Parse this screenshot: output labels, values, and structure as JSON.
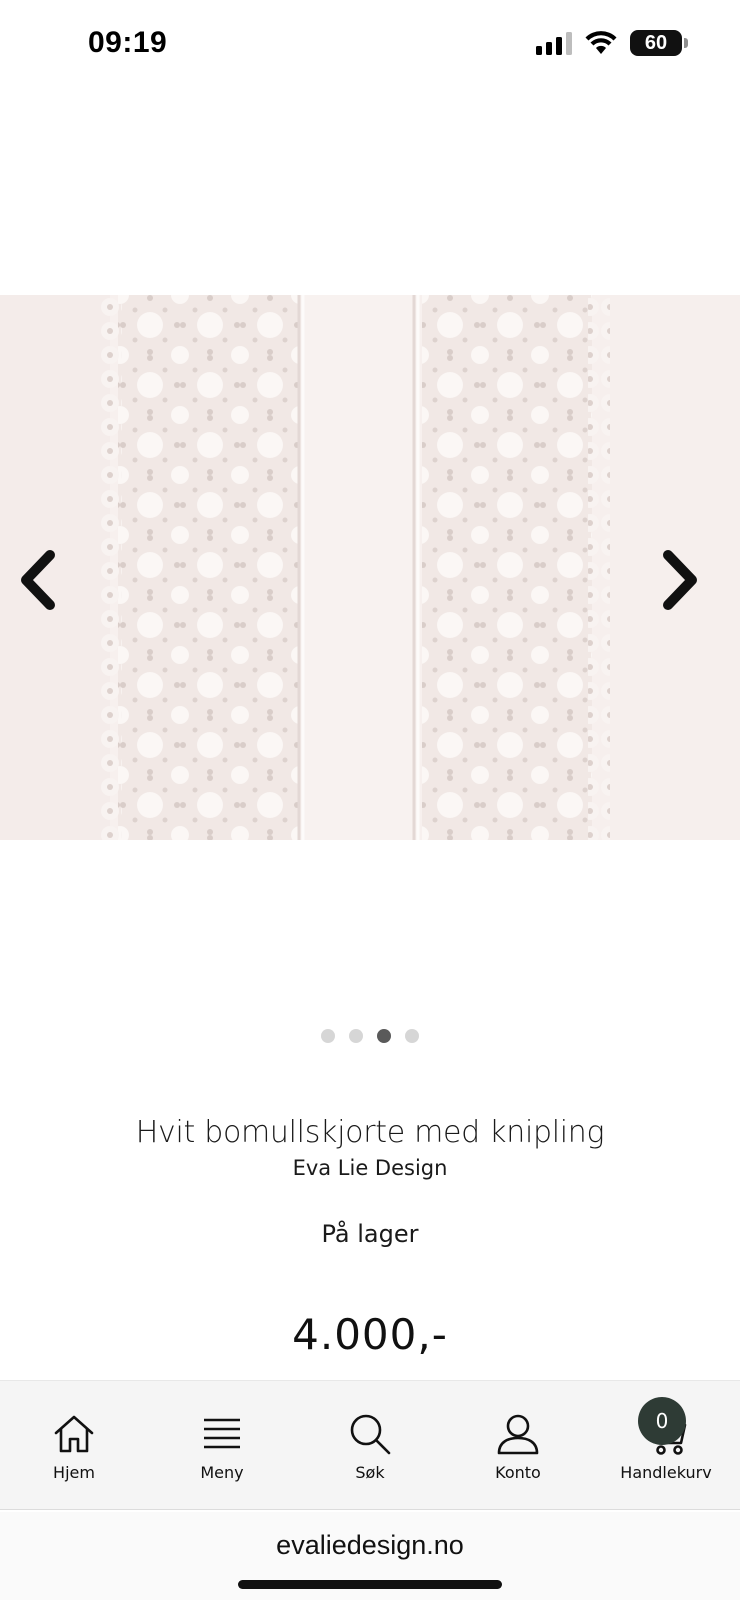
{
  "status_bar": {
    "time": "09:19",
    "battery": "60",
    "icons": [
      "signal-icon",
      "wifi-icon",
      "battery-icon"
    ]
  },
  "gallery": {
    "image_description_icon": "lace-shirt-image",
    "prev_icon": "chevron-left-icon",
    "next_icon": "chevron-right-icon",
    "slide_count": 4,
    "active_slide": 3
  },
  "product": {
    "title": "Hvit bomullskjorte med knipling",
    "brand": "Eva Lie Design",
    "stock": "På lager",
    "price": "4.000,-"
  },
  "bottom_nav": {
    "items": [
      {
        "label": "Hjem",
        "icon": "home-icon"
      },
      {
        "label": "Meny",
        "icon": "menu-icon"
      },
      {
        "label": "Søk",
        "icon": "search-icon"
      },
      {
        "label": "Konto",
        "icon": "user-icon"
      },
      {
        "label": "Handlekurv",
        "icon": "cart-icon"
      }
    ],
    "cart_count": "0"
  },
  "browser": {
    "url": "evaliedesign.no"
  },
  "colors": {
    "badge": "#2e3b35",
    "dot_active": "#5a5a5a",
    "dot_inactive": "#d6d6d6",
    "nav_bg": "#f5f5f5"
  }
}
